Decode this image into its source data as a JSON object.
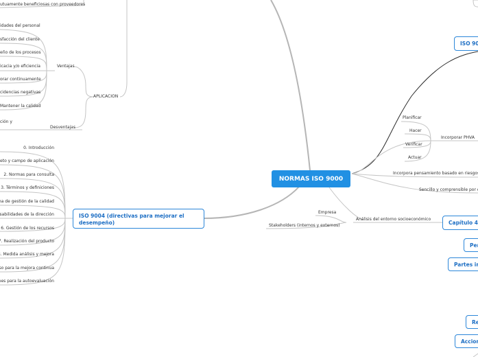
{
  "central": "NORMAS ISO 9000",
  "left_top": {
    "top_item": "utuamente beneficiosas con proveedores",
    "ventajas_label": "Ventajas",
    "ventajas": [
      "idades del personal",
      "sfacción del cliente",
      "eño de los procesos",
      "icacia y/o eficiencia",
      "orar continuamente",
      "cidencias negativas",
      "Mantener la calidad"
    ],
    "aplicacion_label": "APLICACION",
    "desventajas_label": "Desventajas",
    "desventajas_item": "ción y"
  },
  "iso9004": {
    "title": "ISO 9004 (directivas para mejorar el desempeño)",
    "items": [
      "0. Introducción",
      "Objeto y campo de aplicación",
      "2. Normas para consulta",
      "3. Términos y definiciones",
      "ema de gestión de la calidad",
      "onsabilidades de la dirección",
      "6. Gestión de los recursos",
      "7. Realización del producto",
      "8. Medida análisis y mejora",
      "eso para la mejora continua",
      "iones para la autoevaluación"
    ]
  },
  "right": {
    "iso_box": "ISO 90",
    "phva_label": "Incorporar PHVA",
    "phva": [
      "Planificar",
      "Hacer",
      "Verificar",
      "Actuar"
    ],
    "riesgos": "Incorpora pensamiento basado en riesgos",
    "sencillo": "Sencillo y comprensible por cu",
    "analisis": "Análisis del entorno socioeconómico",
    "empresa": "Empresa",
    "stakeholders": "Stakeholders (internos y externos)",
    "capitulo": "Capítulo 4 (",
    "per": "Per",
    "partes": "Partes in",
    "re": "Re",
    "accion": "Accion"
  }
}
